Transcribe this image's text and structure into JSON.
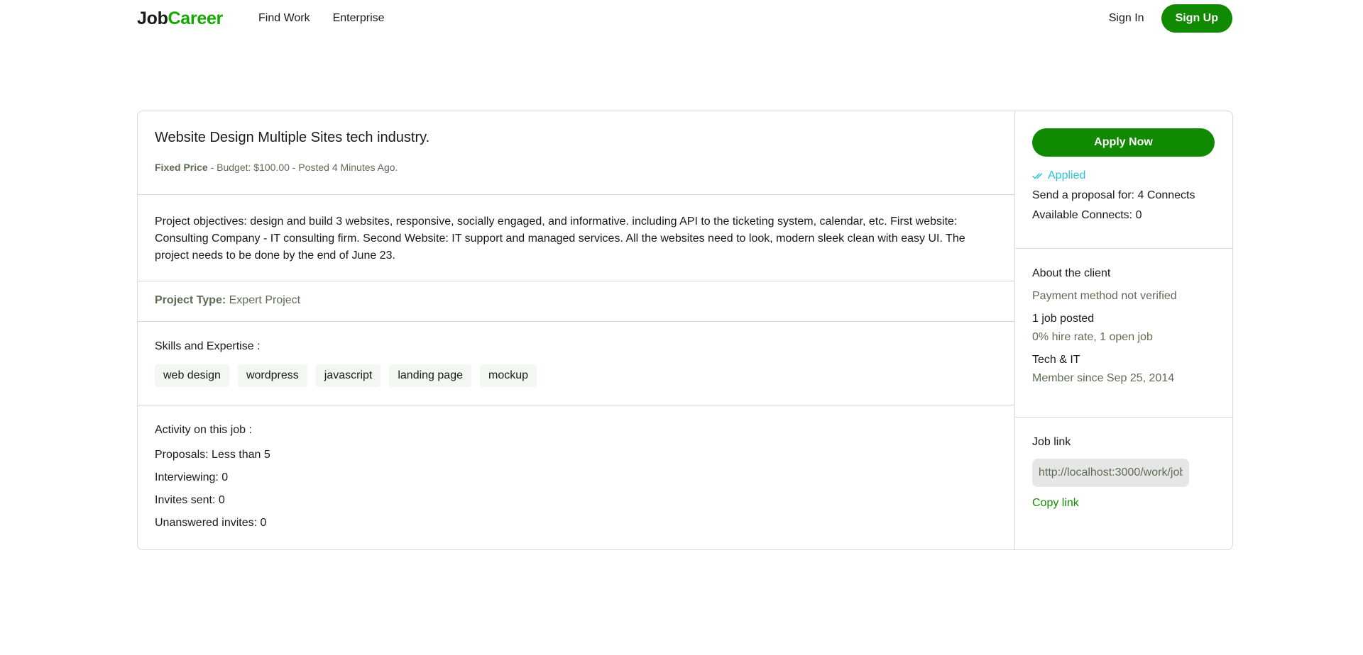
{
  "nav": {
    "logo_part1": "Job",
    "logo_part2": "Career",
    "links": [
      "Find Work",
      "Enterprise"
    ],
    "sign_in": "Sign In",
    "sign_up": "Sign Up"
  },
  "job": {
    "title": "Website Design Multiple Sites tech industry.",
    "price_type": "Fixed Price",
    "meta_rest": "- Budget: $100.00 - Posted 4 Minutes Ago.",
    "description": "Project objectives: design and build 3 websites, responsive, socially engaged, and informative. including API to the ticketing system, calendar, etc. First website: Consulting Company - IT consulting firm. Second Website: IT support and managed services. All the websites need to look, modern sleek clean with easy UI. The project needs to be done by the end of June 23.",
    "project_type_label": "Project Type:",
    "project_type_value": "Expert Project",
    "skills_heading": "Skills and Expertise :",
    "skills": [
      "web design",
      "wordpress",
      "javascript",
      "landing page",
      "mockup"
    ],
    "activity_heading": "Activity on this job :",
    "activity": [
      "Proposals: Less than 5",
      "Interviewing: 0",
      "Invites sent: 0",
      "Unanswered invites: 0"
    ]
  },
  "sidebar": {
    "apply_label": "Apply Now",
    "applied_label": "Applied",
    "proposal_cost": "Send a proposal for: 4 Connects",
    "available_connects": "Available Connects: 0",
    "client_heading": "About the client",
    "payment_status": "Payment method not verified",
    "jobs_posted": "1 job posted",
    "hire_rate": "0% hire rate, 1 open job",
    "industry": "Tech & IT",
    "member_since": "Member since Sep 25, 2014",
    "job_link_heading": "Job link",
    "job_link_value": "http://localhost:3000/work/job",
    "copy_link_label": "Copy link"
  },
  "colors": {
    "brand": "#14a800",
    "button": "#108a00",
    "applied": "#2bc4d6",
    "muted": "#5e6d55"
  },
  "icons": {
    "applied": "double-check-icon"
  }
}
